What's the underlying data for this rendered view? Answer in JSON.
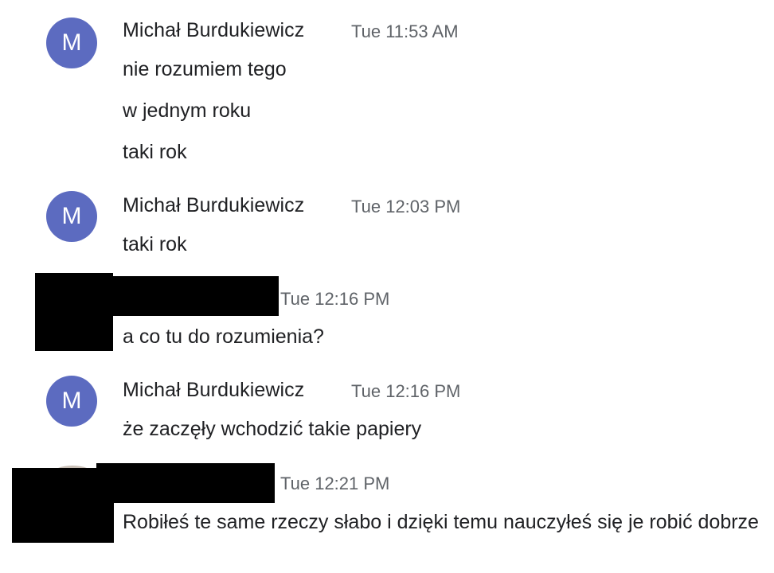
{
  "colors": {
    "avatar_bg": "#5c6bc0",
    "redaction": "#000000",
    "timestamp": "#5f6368",
    "text": "#202124"
  },
  "groups": [
    {
      "avatar_letter": "M",
      "sender": "Michał Burdukiewicz",
      "time": "Tue 11:53 AM",
      "messages": [
        "nie rozumiem tego",
        "w jednym roku",
        "taki rok"
      ]
    },
    {
      "avatar_letter": "M",
      "sender": "Michał Burdukiewicz",
      "time": "Tue 12:03 PM",
      "messages": [
        "taki rok"
      ]
    },
    {
      "sender_redacted": true,
      "time": "Tue 12:16 PM",
      "messages": [
        "a co tu do rozumienia?"
      ]
    },
    {
      "avatar_letter": "M",
      "sender": "Michał Burdukiewicz",
      "time": "Tue 12:16 PM",
      "messages": [
        "że zaczęły wchodzić takie papiery"
      ]
    },
    {
      "sender_redacted": true,
      "time": "Tue 12:21 PM",
      "messages": [
        "Robiłeś te same rzeczy słabo i dzięki temu nauczyłeś się je robić dobrze"
      ]
    }
  ]
}
